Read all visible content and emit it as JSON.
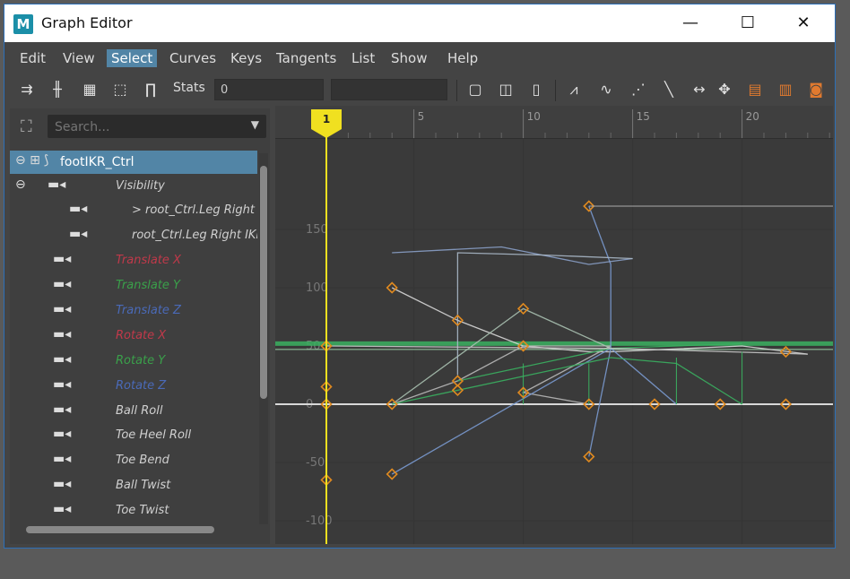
{
  "window": {
    "title": "Graph Editor",
    "app_icon": "M",
    "minimize": "—",
    "maximize": "☐",
    "close": "✕"
  },
  "menu": [
    "Edit",
    "View",
    "Select",
    "Curves",
    "Keys",
    "Tangents",
    "List",
    "Show",
    "Help"
  ],
  "menu_active": "Select",
  "toolbar": {
    "stats_label": "Stats",
    "stats_value": "0",
    "stats_value2": ""
  },
  "search": {
    "placeholder": "Search..."
  },
  "tree": [
    {
      "label": "footIKR_Ctrl",
      "color": "#ffffff",
      "selected": true
    },
    {
      "label": "Visibility",
      "color": "#d0d0d0"
    },
    {
      "label": "> root_Ctrl.Leg Right I",
      "color": "#d0d0d0"
    },
    {
      "label": "root_Ctrl.Leg Right IKF",
      "color": "#d0d0d0"
    },
    {
      "label": "Translate X",
      "color": "#c0394a"
    },
    {
      "label": "Translate Y",
      "color": "#3aa04a"
    },
    {
      "label": "Translate Z",
      "color": "#4a6ab8"
    },
    {
      "label": "Rotate X",
      "color": "#c0394a"
    },
    {
      "label": "Rotate Y",
      "color": "#3aa04a"
    },
    {
      "label": "Rotate Z",
      "color": "#4a6ab8"
    },
    {
      "label": "Ball Roll",
      "color": "#d0d0d0"
    },
    {
      "label": "Toe Heel Roll",
      "color": "#d0d0d0"
    },
    {
      "label": "Toe Bend",
      "color": "#d0d0d0"
    },
    {
      "label": "Ball Twist",
      "color": "#d0d0d0"
    },
    {
      "label": "Toe Twist",
      "color": "#d0d0d0"
    }
  ],
  "graph": {
    "current_frame": "1",
    "x_ticks": [
      "5",
      "10",
      "15",
      "20"
    ],
    "y_ticks": [
      "150",
      "100",
      "50",
      "0",
      "-50",
      "-100"
    ],
    "colors": {
      "key": "#e08a20",
      "timeline": "#f0e020",
      "curve_white": "#d8d8d8",
      "curve_green": "#3ab060",
      "curve_blue": "#7a9ad0"
    }
  }
}
